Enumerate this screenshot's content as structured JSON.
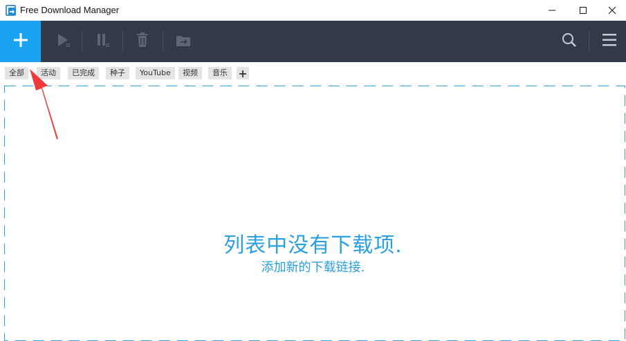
{
  "window": {
    "title": "Free Download Manager"
  },
  "toolbar": {
    "add_icon": "plus-icon",
    "buttons": [
      "play-icon",
      "pause-icon",
      "trash-icon",
      "move-icon"
    ],
    "search_icon": "search-icon",
    "menu_icon": "hamburger-menu-icon",
    "colors": {
      "toolbar_bg": "#323a4a",
      "add_bg": "#1aa3f0",
      "disabled_icon": "#5d6577"
    }
  },
  "filters": {
    "tags": [
      "全部",
      "活动",
      "已完成",
      "种子",
      "YouTube",
      "视频",
      "音乐"
    ]
  },
  "empty_state": {
    "message": "列表中没有下载项.",
    "hint": "添加新的下载链接.",
    "color": "#2b9fe0"
  }
}
